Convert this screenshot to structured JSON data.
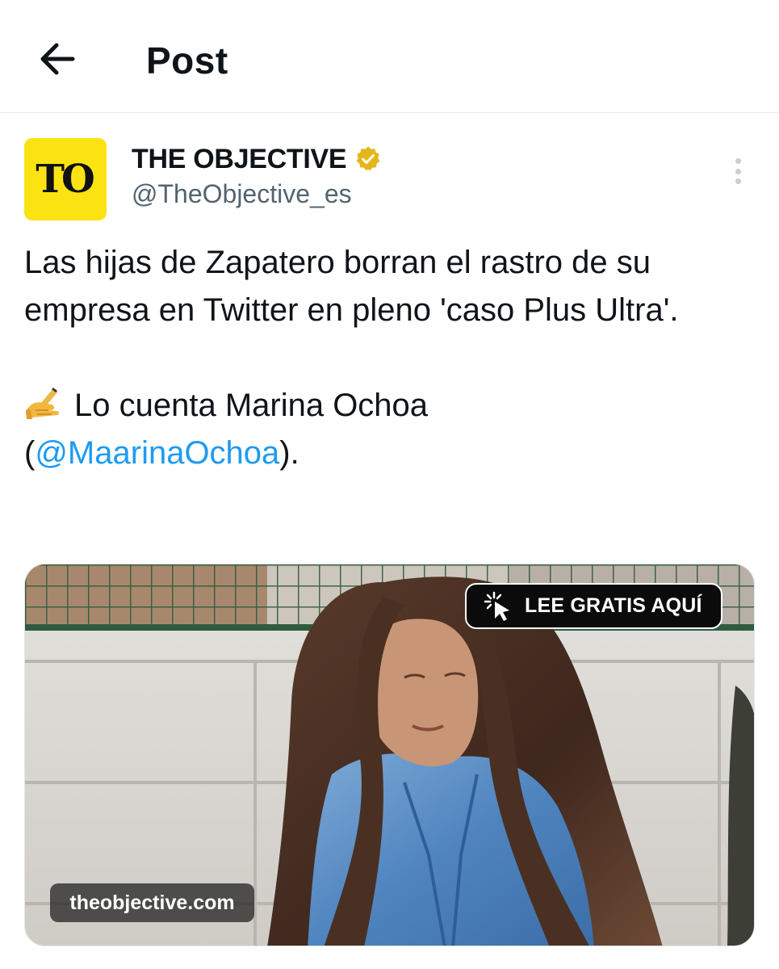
{
  "header": {
    "back_icon": "arrow-left-icon",
    "title": "Post"
  },
  "post": {
    "author": {
      "avatar_text": "TO",
      "avatar_color": "#fbe313",
      "display_name": "THE OBJECTIVE",
      "verified_badge": "gold-verified-icon",
      "verified_color": "#e2b719",
      "handle": "@TheObjective_es"
    },
    "more_icon": "more-vertical-icon",
    "text": {
      "paragraph_1": "Las hijas de Zapatero borran el rastro de su empresa en Twitter en pleno 'caso Plus Ultra'.",
      "emoji": "writing-hand-emoji",
      "paragraph_2_lead": "Lo cuenta Marina Ochoa",
      "open_paren": "(",
      "mention": "@MaarinaOchoa",
      "close_paren": ")."
    },
    "media": {
      "cta_label": "LEE GRATIS AQUÍ",
      "cta_icon": "cursor-click-icon",
      "domain_label": "theobjective.com"
    }
  },
  "colors": {
    "link": "#1d9bf0",
    "secondary_text": "#536471",
    "primary_text": "#0f1419"
  }
}
